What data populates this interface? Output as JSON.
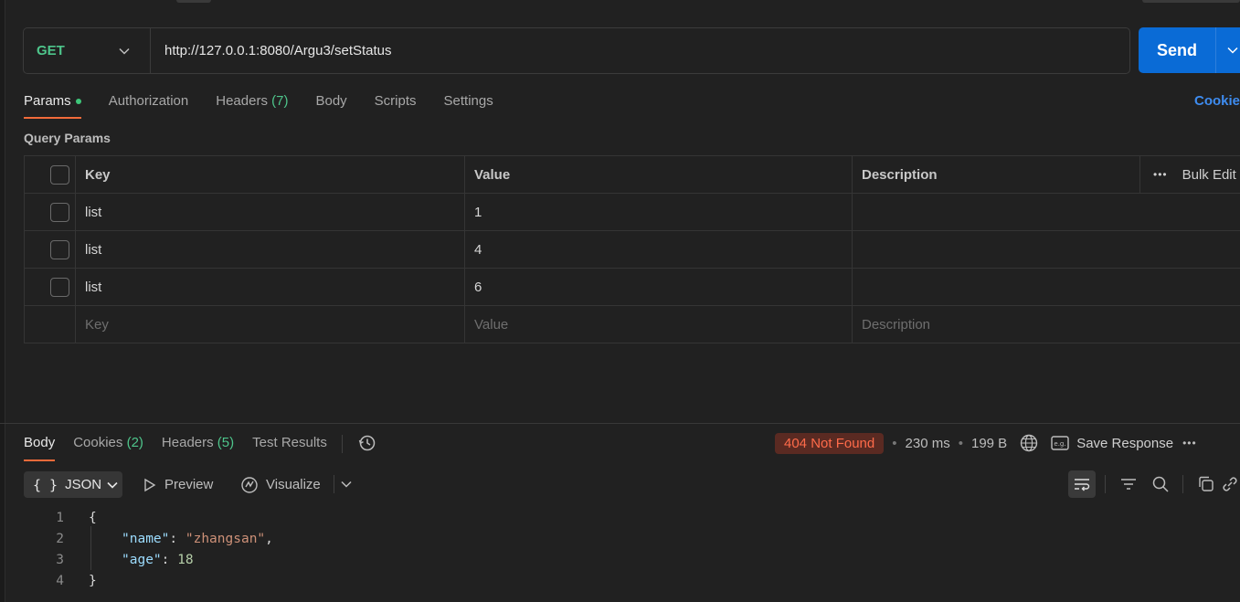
{
  "request": {
    "method": "GET",
    "url": "http://127.0.0.1:8080/Argu3/setStatus",
    "send_label": "Send"
  },
  "request_tabs": [
    {
      "label": "Params",
      "active": true
    },
    {
      "label": "Authorization"
    },
    {
      "label": "Headers",
      "count": "(7)"
    },
    {
      "label": "Body"
    },
    {
      "label": "Scripts"
    },
    {
      "label": "Settings"
    }
  ],
  "cookies_link": "Cookie",
  "query_params": {
    "title": "Query Params",
    "headers": [
      "Key",
      "Value",
      "Description"
    ],
    "bulk_edit": "Bulk Edit",
    "rows": [
      {
        "key": "list",
        "value": "1",
        "description": ""
      },
      {
        "key": "list",
        "value": "4",
        "description": ""
      },
      {
        "key": "list",
        "value": "6",
        "description": ""
      }
    ],
    "placeholder": {
      "key": "Key",
      "value": "Value",
      "description": "Description"
    }
  },
  "response_tabs": [
    {
      "label": "Body",
      "active": true
    },
    {
      "label": "Cookies",
      "count": "(2)"
    },
    {
      "label": "Headers",
      "count": "(5)"
    },
    {
      "label": "Test Results"
    }
  ],
  "response_status": {
    "status": "404 Not Found",
    "time": "230 ms",
    "size": "199 B",
    "save_label": "Save Response"
  },
  "response_toolbar": {
    "format": "JSON",
    "preview": "Preview",
    "visualize": "Visualize"
  },
  "response_body": {
    "line_numbers": [
      "1",
      "2",
      "3",
      "4"
    ],
    "open_brace": "{",
    "close_brace": "}",
    "name_key": "\"name\"",
    "name_value": "\"zhangsan\"",
    "age_key": "\"age\"",
    "age_value": "18"
  },
  "colors": {
    "accent_tab": "#f26b3a",
    "method_get": "#4ec58b",
    "send_button": "#0a6bd6",
    "status_error": "#ff6b4a"
  }
}
